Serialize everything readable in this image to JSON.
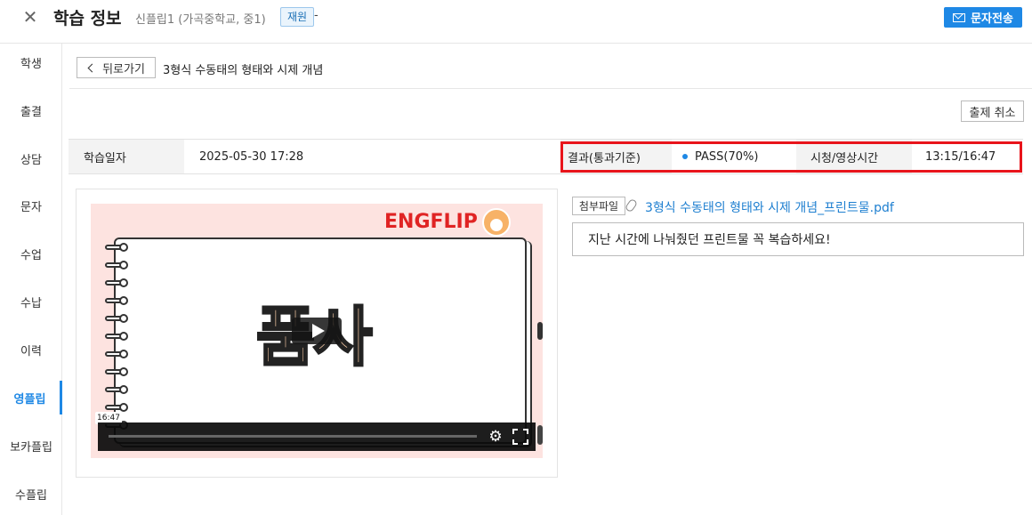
{
  "header": {
    "close_glyph": "✕",
    "title": "학습 정보",
    "student": "신플립1 (가곡중학교, 중1)",
    "status_badge": "재원",
    "status_suffix": "-",
    "sms_button": "문자전송"
  },
  "sidebar": {
    "items": [
      {
        "label": "학생"
      },
      {
        "label": "출결"
      },
      {
        "label": "상담"
      },
      {
        "label": "문자"
      },
      {
        "label": "수업"
      },
      {
        "label": "수납"
      },
      {
        "label": "이력"
      },
      {
        "label": "영플립"
      },
      {
        "label": "보카플립"
      },
      {
        "label": "수플립"
      }
    ],
    "active": "영플립"
  },
  "main": {
    "back_button": "뒤로가기",
    "lesson_title": "3형식 수동태의 형태와 시제 개념",
    "cancel_button": "출제 취소",
    "info": {
      "date_label": "학습일자",
      "date_value": "2025-05-30 17:28",
      "result_label": "결과(통과기준)",
      "result_value": "PASS(70%)",
      "watch_label": "시청/영상시간",
      "watch_value": "13:15/16:47"
    },
    "video": {
      "brand": "ENGFLIP",
      "big_word": "품사",
      "time_tooltip": "16:47",
      "progress": 0.0,
      "gear_glyph": "⚙"
    },
    "attachment": {
      "label": "첨부파일",
      "file_name": "3형식 수동태의 형태와 시제 개념_프린트물.pdf"
    },
    "memo": "지난 시간에 나눠줬던 프린트물 꼭 복습하세요!"
  },
  "colors": {
    "accent": "#1e88e5",
    "highlight_border": "#e8141b",
    "brand_red": "#e02424",
    "thumb_bg": "#fde3e0"
  }
}
